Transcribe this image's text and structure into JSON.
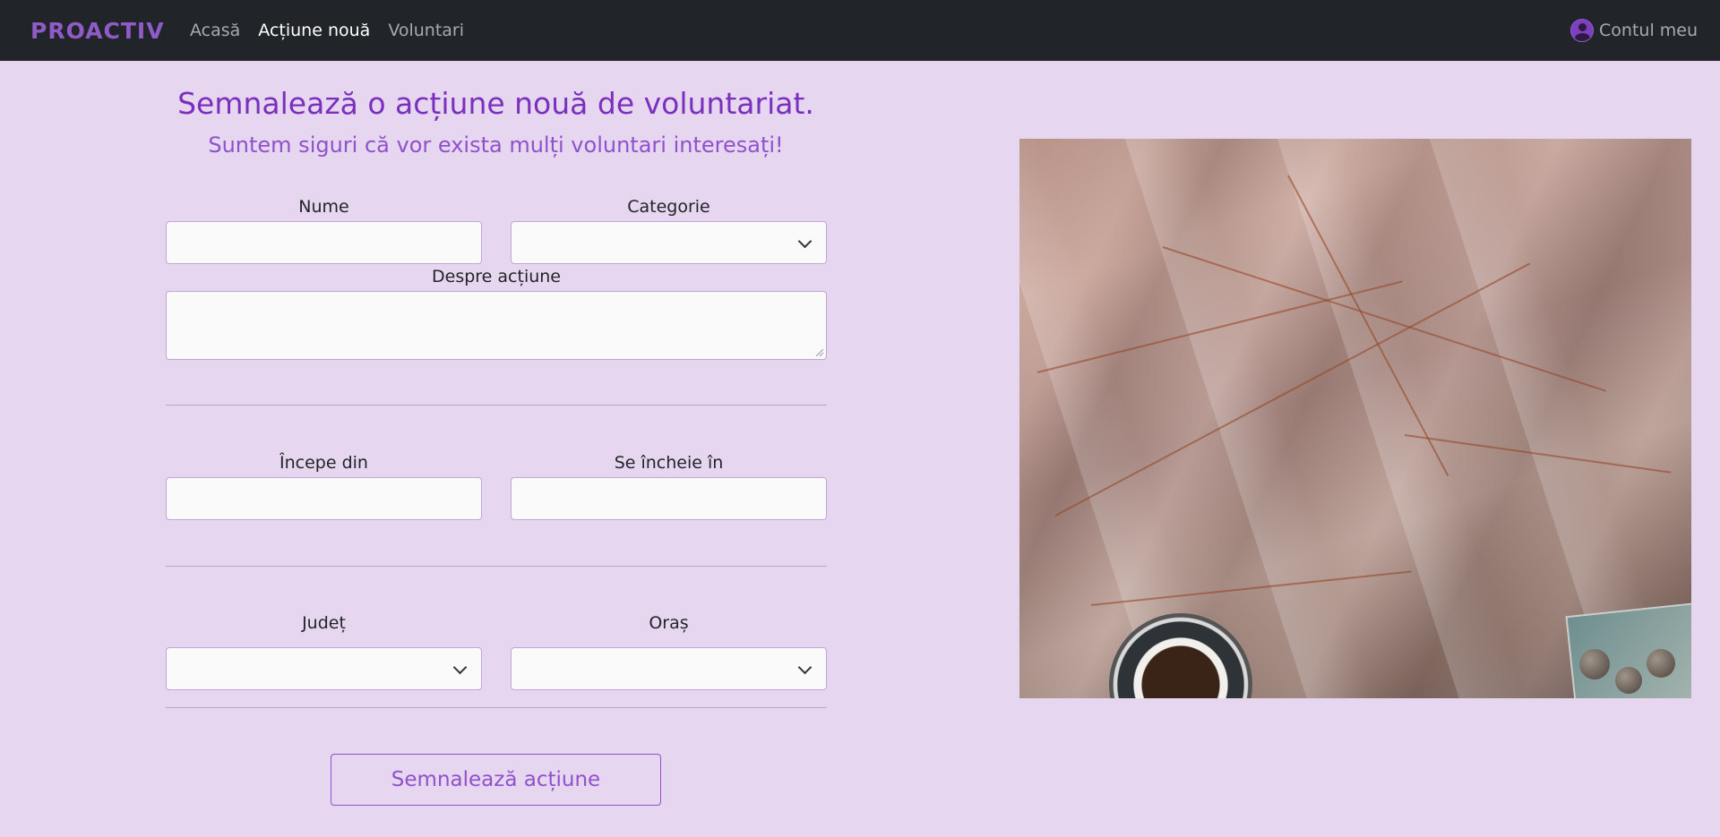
{
  "nav": {
    "brand": "PROACTIV",
    "links": [
      {
        "label": "Acasă"
      },
      {
        "label": "Acțiune nouă"
      },
      {
        "label": "Voluntari"
      }
    ],
    "account_label": "Contul meu"
  },
  "page": {
    "title": "Semnalează o acțiune nouă de voluntariat.",
    "subtitle": "Suntem siguri că vor exista mulți voluntari interesați!"
  },
  "form": {
    "name_label": "Nume",
    "name_value": "",
    "category_label": "Categorie",
    "category_value": "",
    "about_label": "Despre acțiune",
    "about_value": "",
    "start_label": "Începe din",
    "start_value": "",
    "end_label": "Se încheie în",
    "end_value": "",
    "county_label": "Județ",
    "county_value": "",
    "city_label": "Oraș",
    "city_value": "",
    "submit_label": "Semnalează acțiune"
  },
  "colors": {
    "background": "#e6d6ef",
    "navbar": "#212529",
    "accent": "#7b2fbe",
    "accent_light": "#8f52cc"
  }
}
